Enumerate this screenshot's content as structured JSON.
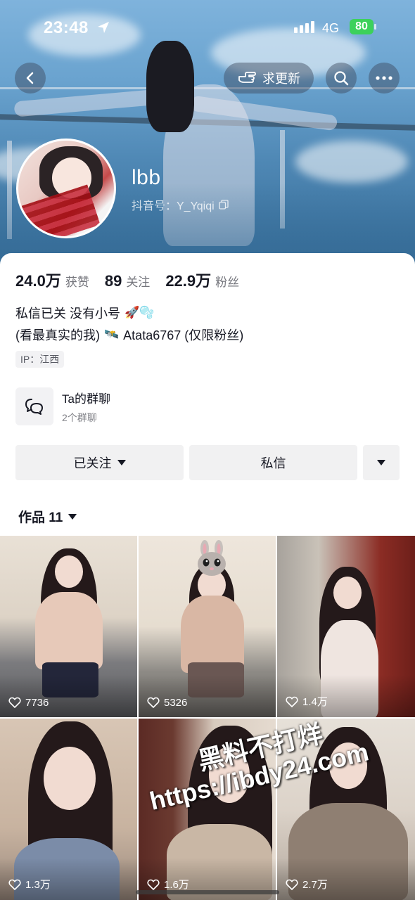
{
  "status_bar": {
    "time": "23:48",
    "network": "4G",
    "battery": "80"
  },
  "header": {
    "update_button_label": "求更新"
  },
  "profile": {
    "username": "lbb",
    "douyin_id": "抖音号：Y_Yqiqi",
    "stats": [
      {
        "value": "24.0万",
        "label": "获赞"
      },
      {
        "value": "89",
        "label": "关注"
      },
      {
        "value": "22.9万",
        "label": "粉丝"
      }
    ],
    "bio_line1": "私信已关  没有小号",
    "bio_line1_emoji": "🚀🫧",
    "bio_line2_a": "(看最真实的我)",
    "bio_line2_emoji": "🛰️",
    "bio_line2_b": "Atata6767 (仅限粉丝)",
    "ip_tag": "IP：江西"
  },
  "group_chat": {
    "title": "Ta的群聊",
    "subtitle": "2个群聊"
  },
  "actions": {
    "follow_label": "已关注",
    "message_label": "私信"
  },
  "works_tab": {
    "label": "作品 11"
  },
  "videos": [
    {
      "likes": "7736"
    },
    {
      "likes": "5326"
    },
    {
      "likes": "1.4万"
    },
    {
      "likes": "1.3万"
    },
    {
      "likes": "1.6万"
    },
    {
      "likes": "2.7万"
    }
  ],
  "watermark": {
    "line1": "黑料不打烊",
    "line2": "https://ibdy24.com"
  },
  "colors": {
    "accent_battery": "#3cd15b",
    "text_primary": "#161823",
    "button_bg": "#f1f1f2"
  }
}
